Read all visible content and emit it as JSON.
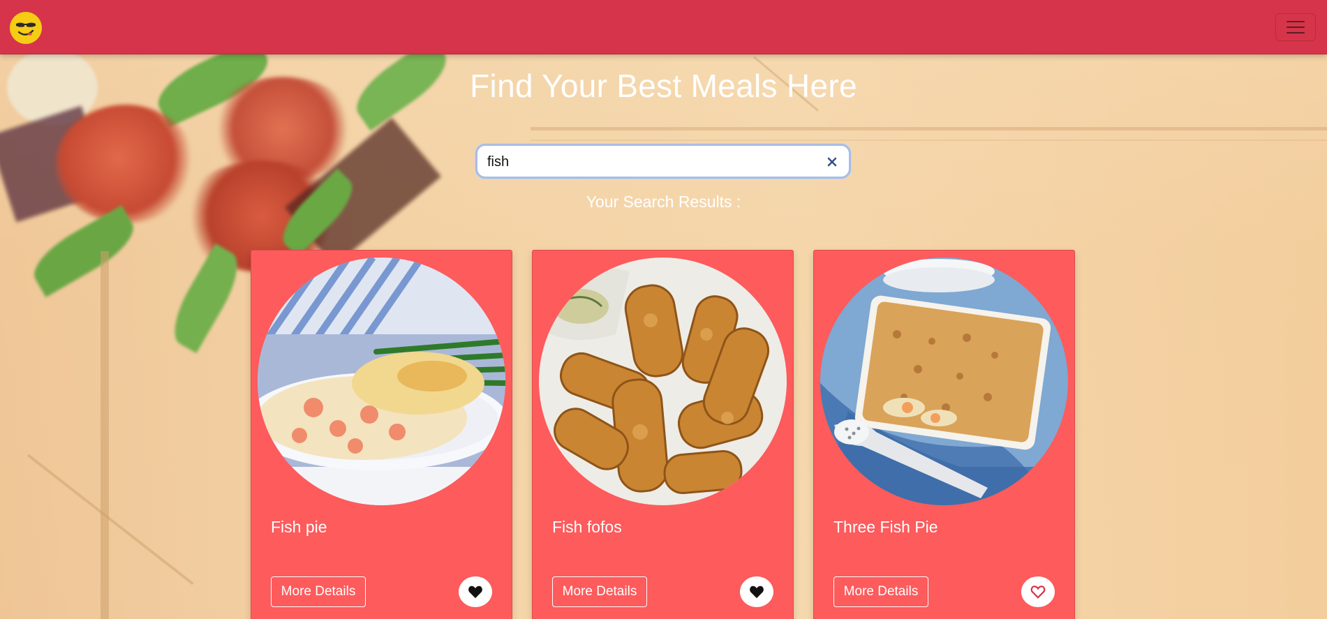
{
  "app": {
    "logo_icon": "smiley-sunglasses-icon",
    "menu_icon": "hamburger-menu-icon"
  },
  "hero": {
    "title": "Find Your Best Meals Here"
  },
  "search": {
    "value": "fish",
    "clear_icon": "close-icon"
  },
  "results": {
    "label": "Your Search Results :",
    "cards": [
      {
        "title": "Fish pie",
        "details_label": "More Details",
        "favorite": true,
        "image": "fish-pie-photo"
      },
      {
        "title": "Fish fofos",
        "details_label": "More Details",
        "favorite": true,
        "image": "fish-fofos-photo"
      },
      {
        "title": "Three Fish Pie",
        "details_label": "More Details",
        "favorite": false,
        "image": "three-fish-pie-photo"
      }
    ]
  },
  "colors": {
    "navbar": "#d6344a",
    "card": "#fd5b5c",
    "logo": "#f7cc15",
    "heart_filled": "#111111",
    "heart_outline": "#d6344a"
  }
}
